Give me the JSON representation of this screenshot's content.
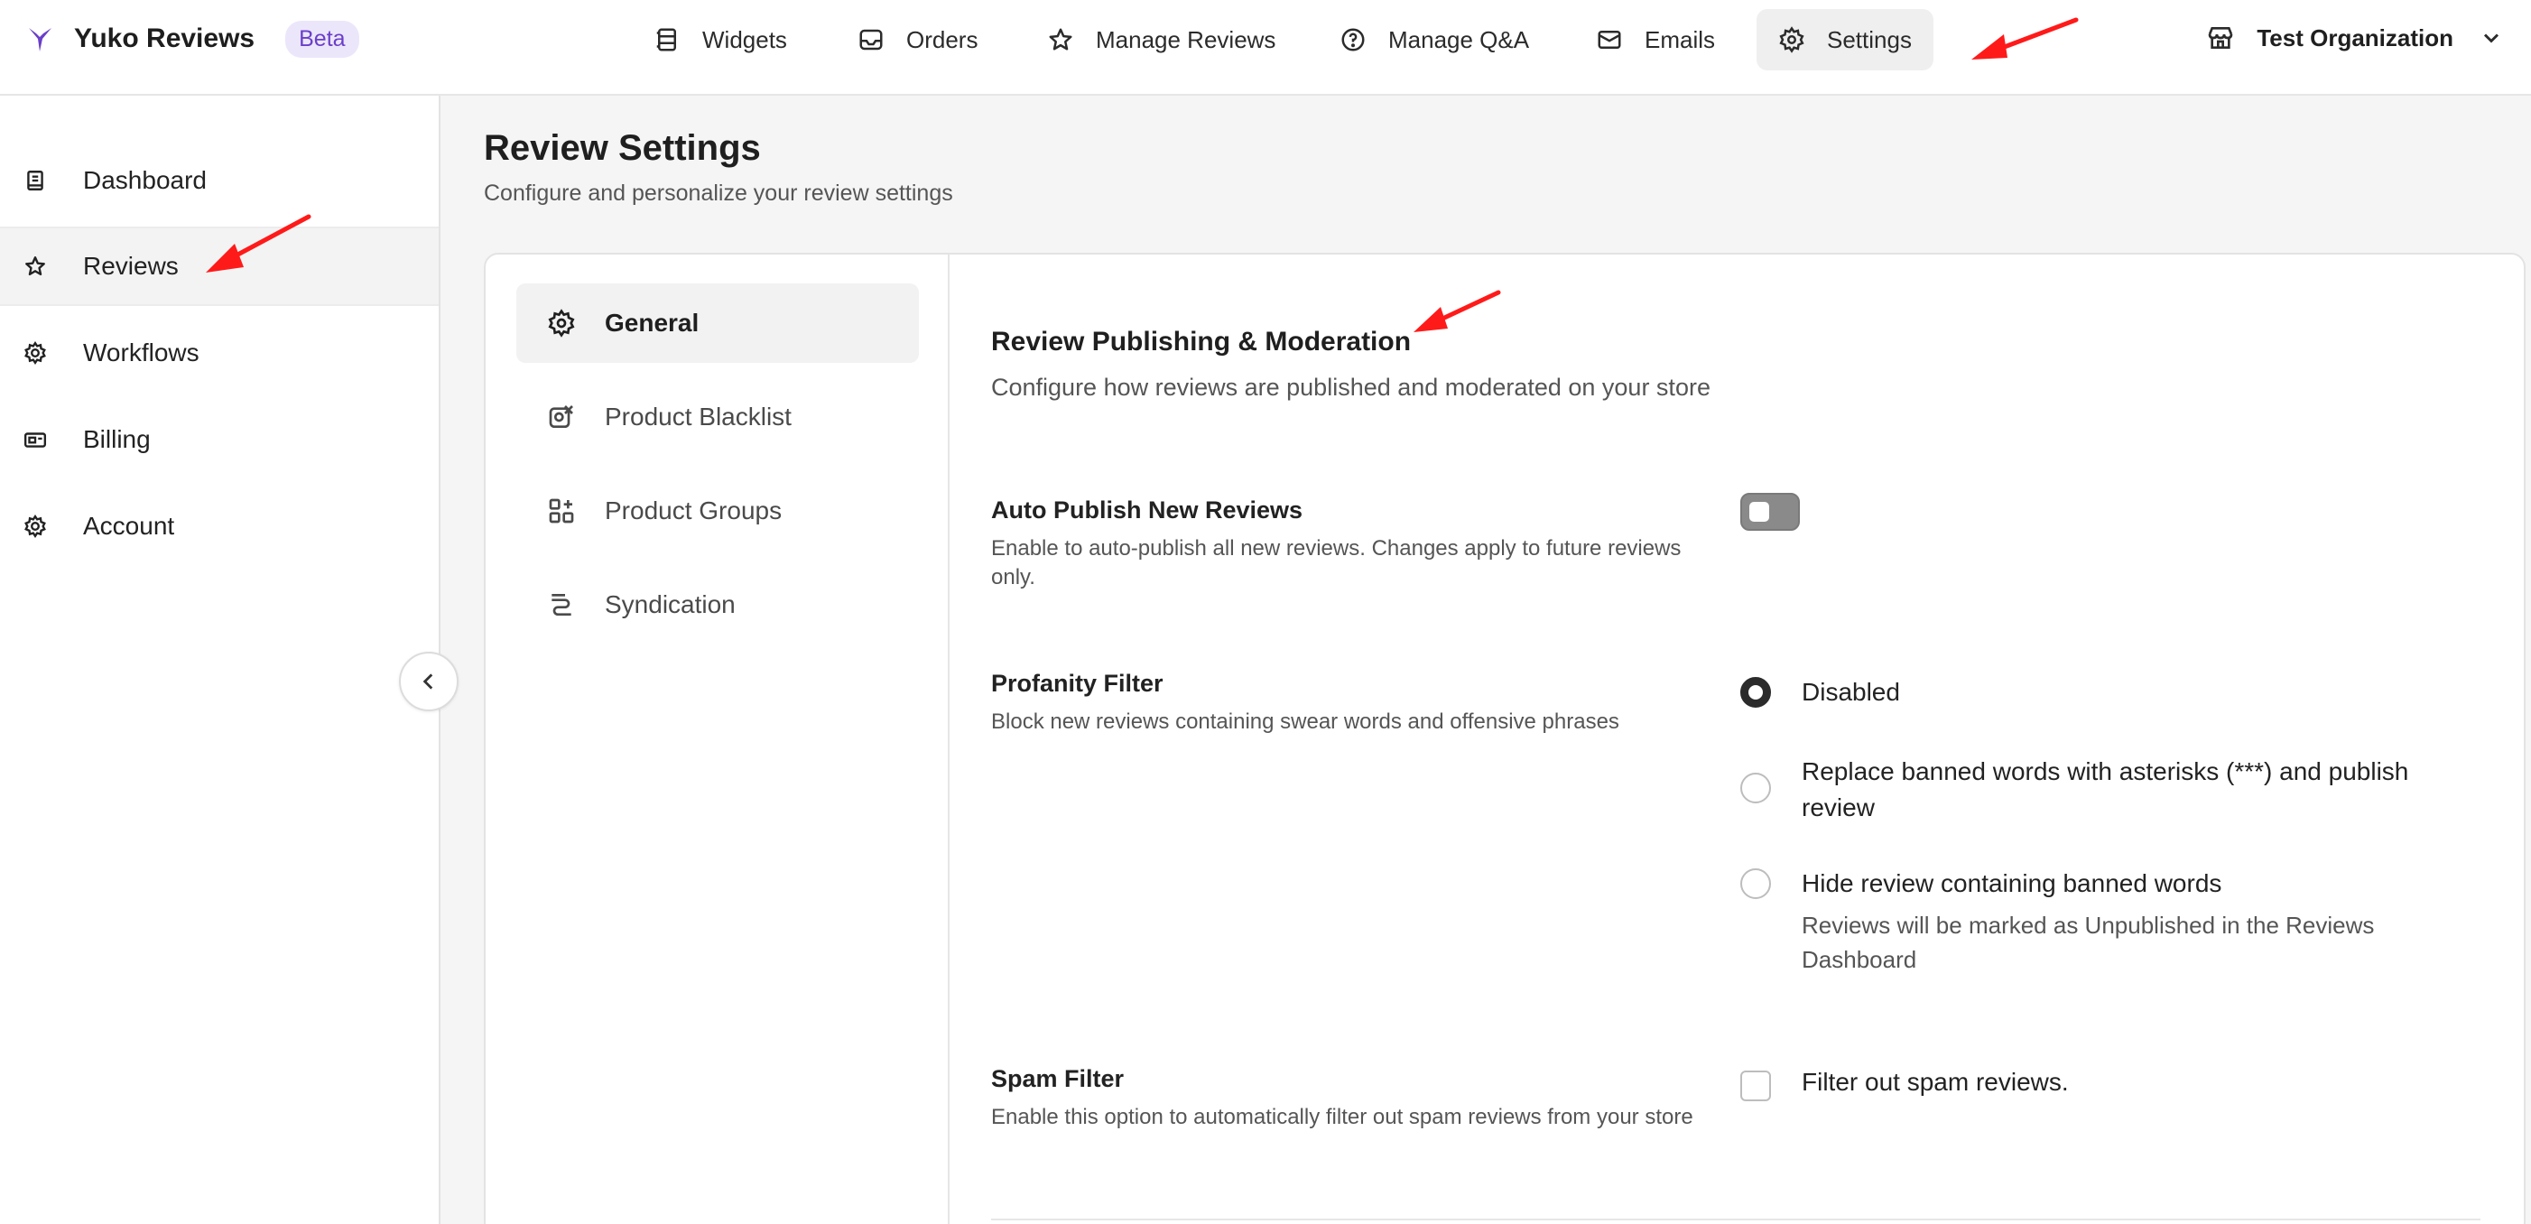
{
  "colors": {
    "accent": "#6a3fc9",
    "arrow": "#ff1a1a",
    "toggle_off": "#8a8a8a"
  },
  "app": {
    "name": "Yuko Reviews",
    "badge": "Beta",
    "logo_icon": "yuko-logo-icon"
  },
  "nav": {
    "items": [
      {
        "label": "Widgets",
        "icon": "widgets-icon"
      },
      {
        "label": "Orders",
        "icon": "inbox-icon"
      },
      {
        "label": "Manage Reviews",
        "icon": "star-icon"
      },
      {
        "label": "Manage Q&A",
        "icon": "question-circle-icon"
      },
      {
        "label": "Emails",
        "icon": "mail-icon"
      },
      {
        "label": "Settings",
        "icon": "gear-icon",
        "active": true
      }
    ]
  },
  "org": {
    "name": "Test Organization",
    "icon": "store-icon"
  },
  "sidebar": {
    "items": [
      {
        "label": "Dashboard",
        "icon": "book-icon"
      },
      {
        "label": "Reviews",
        "icon": "star-icon",
        "active": true
      },
      {
        "label": "Workflows",
        "icon": "cog-icon"
      },
      {
        "label": "Billing",
        "icon": "billing-icon"
      },
      {
        "label": "Account",
        "icon": "gear-icon"
      }
    ]
  },
  "page": {
    "title": "Review Settings",
    "subtitle": "Configure and personalize your review settings"
  },
  "settings_nav": {
    "items": [
      {
        "label": "General",
        "icon": "gear-icon",
        "active": true
      },
      {
        "label": "Product Blacklist",
        "icon": "blacklist-icon"
      },
      {
        "label": "Product Groups",
        "icon": "groups-icon"
      },
      {
        "label": "Syndication",
        "icon": "syndication-icon"
      }
    ]
  },
  "section": {
    "title": "Review Publishing & Moderation",
    "description": "Configure how reviews are published and moderated on your store"
  },
  "auto_publish": {
    "label": "Auto Publish New Reviews",
    "description": "Enable to auto-publish all new reviews. Changes apply to future reviews only.",
    "enabled": false
  },
  "profanity": {
    "label": "Profanity Filter",
    "description": "Block new reviews containing swear words and offensive phrases",
    "options": [
      {
        "label": "Disabled",
        "checked": true
      },
      {
        "label": "Replace banned words with asterisks (***) and publish review",
        "checked": false
      },
      {
        "label": "Hide review containing banned words",
        "checked": false
      }
    ],
    "hide_help": "Reviews will be marked as Unpublished in the Reviews Dashboard"
  },
  "spam": {
    "label": "Spam Filter",
    "description": "Enable this option to automatically filter out spam reviews from your store",
    "checkbox_label": "Filter out spam reviews.",
    "checked": false
  }
}
